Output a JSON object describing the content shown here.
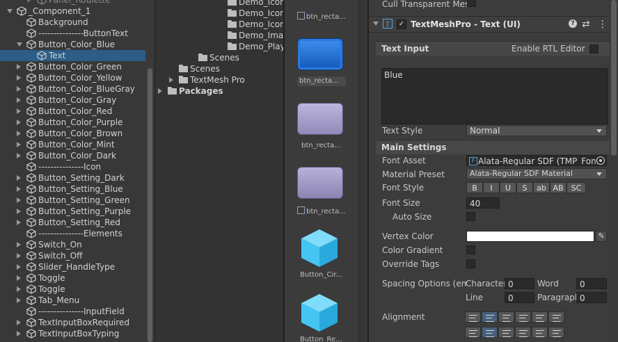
{
  "hierarchy": {
    "items": [
      {
        "label": "Panel_Roulette"
      },
      {
        "label": "_Component_1"
      },
      {
        "label": "Background"
      },
      {
        "label": "---------------ButtonText"
      },
      {
        "label": "Button_Color_Blue"
      },
      {
        "label": "Text"
      },
      {
        "label": "Button_Color_Green"
      },
      {
        "label": "Button_Color_Yellow"
      },
      {
        "label": "Button_Color_BlueGray"
      },
      {
        "label": "Button_Color_Gray"
      },
      {
        "label": "Button_Color_Red"
      },
      {
        "label": "Button_Color_Purple"
      },
      {
        "label": "Button_Color_Brown"
      },
      {
        "label": "Button_Color_Mint"
      },
      {
        "label": "Button_Color_Dark"
      },
      {
        "label": "---------------Icon"
      },
      {
        "label": "Button_Setting_Dark"
      },
      {
        "label": "Button_Setting_Blue"
      },
      {
        "label": "Button_Setting_Green"
      },
      {
        "label": "Button_Setting_Purple"
      },
      {
        "label": "Button_Setting_Red"
      },
      {
        "label": "---------------Elements"
      },
      {
        "label": "Switch_On"
      },
      {
        "label": "Switch_Off"
      },
      {
        "label": "Slider_HandleType"
      },
      {
        "label": "Toggle"
      },
      {
        "label": "Toggle"
      },
      {
        "label": "Tab_Menu"
      },
      {
        "label": "---------------InputField"
      },
      {
        "label": "TextInputBoxRequired"
      },
      {
        "label": "TextInputBoxTyping"
      }
    ]
  },
  "project": {
    "items": [
      {
        "label": "Demo_Icon"
      },
      {
        "label": "Demo_Icon_"
      },
      {
        "label": "Demo_Icon_"
      },
      {
        "label": "Demo_Imag"
      },
      {
        "label": "Demo_Play"
      },
      {
        "label": "Scenes"
      },
      {
        "label": "Scenes"
      },
      {
        "label": "TextMesh Pro"
      },
      {
        "label": "Packages"
      }
    ]
  },
  "assets": {
    "items": [
      {
        "label": "btn_recta..."
      },
      {
        "label": "btn_recta..."
      },
      {
        "label": "btn_recta..."
      },
      {
        "label": "btn_recta..."
      },
      {
        "label": "Button_Cir..."
      },
      {
        "label": "Button_Re..."
      }
    ]
  },
  "inspector": {
    "cull_transparent": "Cull Transparent Mes",
    "component_title": "TextMeshPro - Text (UI)",
    "text_input_header": "Text Input",
    "enable_rtl": "Enable RTL Editor",
    "text_value": "Blue",
    "text_style_label": "Text Style",
    "text_style_value": "Normal",
    "main_settings": "Main Settings",
    "font_asset_label": "Font Asset",
    "font_asset_value": "Alata-Regular SDF (TMP_Font",
    "material_preset_label": "Material Preset",
    "material_preset_value": "Alata-Regular SDF Material",
    "font_style_label": "Font Style",
    "font_style_buttons": [
      "B",
      "I",
      "U",
      "S",
      "ab",
      "AB",
      "SC"
    ],
    "font_size_label": "Font Size",
    "font_size_value": "40",
    "auto_size_label": "Auto Size",
    "vertex_color_label": "Vertex Color",
    "color_gradient_label": "Color Gradient",
    "override_tags_label": "Override Tags",
    "spacing_label": "Spacing Options (em)",
    "character_label": "Character",
    "character_value": "0",
    "word_label": "Word",
    "word_value": "0",
    "line_label": "Line",
    "line_value": "0",
    "paragraph_label": "Paragraph",
    "paragraph_value": "0",
    "alignment_label": "Alignment"
  },
  "colors": {
    "selection": "#2c5d87",
    "button_blue": "#1f6fd0",
    "button_lavender": "#a79fcb",
    "icon_cyan": "#45c6f2"
  }
}
